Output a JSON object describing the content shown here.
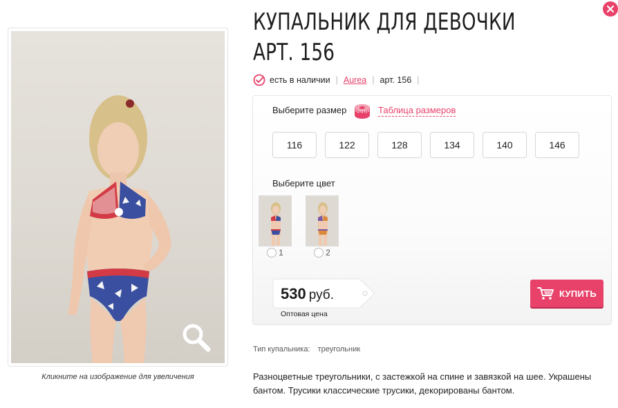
{
  "product": {
    "title": "КУПАЛЬНИК ДЛЯ ДЕВОЧКИ АРТ. 156",
    "availability": "есть в наличии",
    "brand": "Aurea",
    "article": "арт. 156"
  },
  "image": {
    "caption": "Кликните на изображение для увеличения"
  },
  "sizes": {
    "label": "Выберите размер",
    "table_link": "Таблица размеров",
    "options": [
      "116",
      "122",
      "128",
      "134",
      "140",
      "146"
    ]
  },
  "colors": {
    "label": "Выберите цвет",
    "options": [
      {
        "label": "1",
        "selected": false
      },
      {
        "label": "2",
        "selected": false
      }
    ]
  },
  "price": {
    "value": "530",
    "currency": "руб.",
    "note": "Оптовая цена"
  },
  "buy_button": {
    "label": "КУПИТЬ"
  },
  "specs": {
    "type_label": "Тип купальника:",
    "type_value": "треугольник"
  },
  "description": "Разноцветные треугольники, с застежкой на спине и завязкой на шее. Украшены бантом. Трусики классические трусики, декорированы бантом.",
  "theme": {
    "accent": "#e8426a",
    "border": "#e3e3e3"
  }
}
